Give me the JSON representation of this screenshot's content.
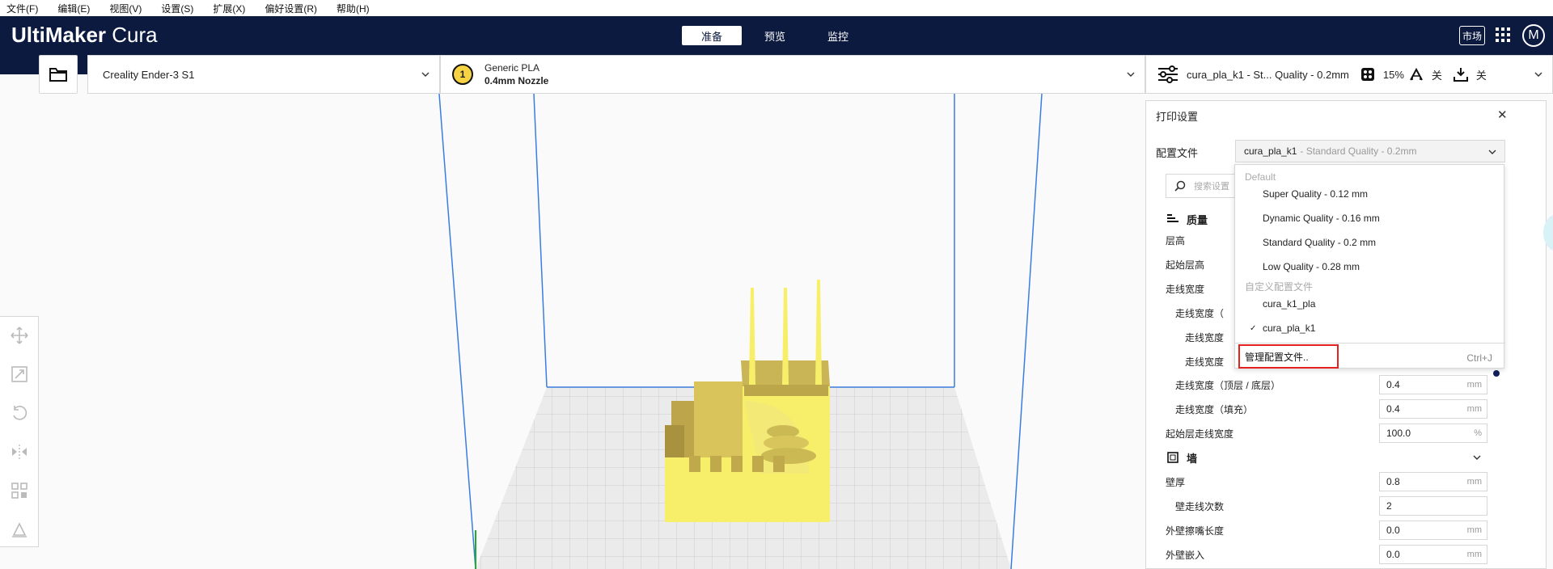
{
  "menu": [
    "文件(F)",
    "编辑(E)",
    "视图(V)",
    "设置(S)",
    "扩展(X)",
    "偏好设置(R)",
    "帮助(H)"
  ],
  "app": {
    "logo_bold": "UltiMaker",
    "logo_light": "Cura"
  },
  "stages": [
    {
      "label": "准备",
      "active": true
    },
    {
      "label": "预览",
      "active": false
    },
    {
      "label": "监控",
      "active": false
    }
  ],
  "header": {
    "marketplace": "市场",
    "account_initial": "M"
  },
  "printer": {
    "name": "Creality Ender-3 S1"
  },
  "material": {
    "extruder": "1",
    "name": "Generic PLA",
    "nozzle": "0.4mm Nozzle"
  },
  "profile_bar": {
    "profile": "cura_pla_k1 - St... Quality - 0.2mm",
    "infill": "15%",
    "support": "关",
    "adhesion": "关"
  },
  "settings": {
    "title": "打印设置",
    "profile_label": "配置文件",
    "profile_name": "cura_pla_k1",
    "profile_quality": "- Standard Quality - 0.2mm",
    "search_placeholder": "搜索设置",
    "categories": {
      "quality": "质量",
      "walls": "墙"
    },
    "rows": [
      {
        "label": "层高"
      },
      {
        "label": "起始层高"
      },
      {
        "label": "走线宽度"
      },
      {
        "label": "走线宽度（"
      },
      {
        "label": "走线宽度"
      },
      {
        "label": "走线宽度"
      },
      {
        "label": "走线宽度（顶层 / 底层）",
        "value": "0.4",
        "unit": "mm"
      },
      {
        "label": "走线宽度（填充）",
        "value": "0.4",
        "unit": "mm"
      },
      {
        "label": "起始层走线宽度",
        "value": "100.0",
        "unit": "%"
      },
      {
        "label": "壁厚",
        "value": "0.8",
        "unit": "mm"
      },
      {
        "label": "壁走线次数",
        "value": "2",
        "unit": ""
      },
      {
        "label": "外壁擦嘴长度",
        "value": "0.0",
        "unit": "mm"
      },
      {
        "label": "外壁嵌入",
        "value": "0.0",
        "unit": "mm"
      }
    ]
  },
  "popup": {
    "default_header": "Default",
    "defaults": [
      "Super Quality - 0.12 mm",
      "Dynamic Quality - 0.16 mm",
      "Standard Quality - 0.2 mm",
      "Low Quality - 0.28 mm"
    ],
    "custom_header": "自定义配置文件",
    "customs": [
      "cura_k1_pla",
      "cura_pla_k1"
    ],
    "checked": "cura_pla_k1",
    "check_mark": "✓",
    "manage": "管理配置文件..",
    "shortcut": "Ctrl+J"
  },
  "colors": {
    "header_bg": "#0c1a40",
    "model_yellow": "#f7ef6a",
    "build_plate": "#e8e8e8",
    "highlight_red": "#e52222",
    "volume_edge": "#3a7de0"
  }
}
